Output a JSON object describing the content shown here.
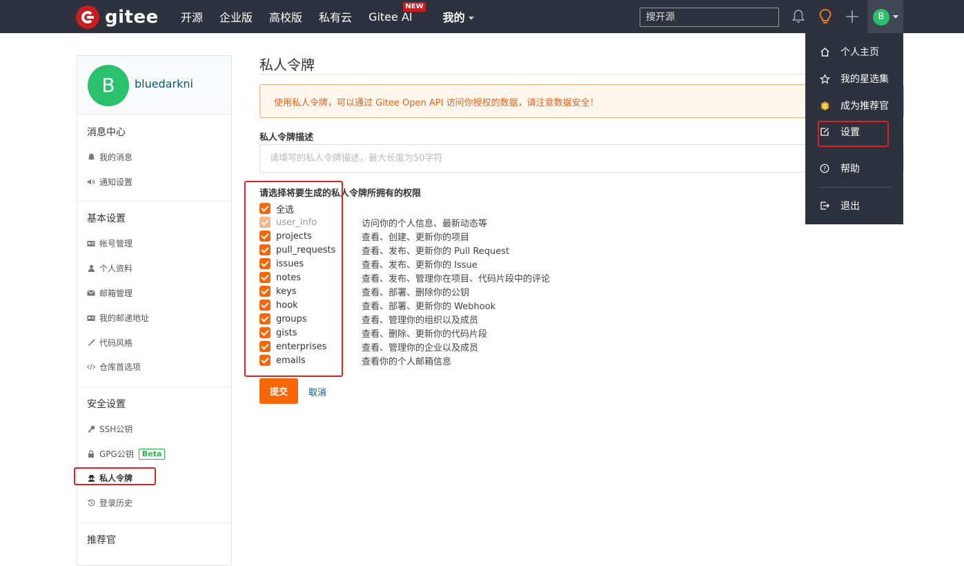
{
  "topbar": {
    "logo_text": "gitee",
    "nav": [
      {
        "label": "开源"
      },
      {
        "label": "企业版"
      },
      {
        "label": "高校版"
      },
      {
        "label": "私有云"
      },
      {
        "label": "Gitee AI",
        "badge": "NEW"
      },
      {
        "label": "我的"
      }
    ],
    "search_placeholder": "搜开源",
    "avatar_letter": "B",
    "icons": [
      "bell-icon",
      "lightbulb-icon",
      "plus-icon"
    ]
  },
  "dropdown": {
    "items": [
      {
        "label": "个人主页",
        "icon": "home-icon"
      },
      {
        "label": "我的星选集",
        "icon": "star-icon"
      },
      {
        "label": "成为推荐官",
        "icon": "gitee-badge-icon"
      },
      {
        "label": "设置",
        "icon": "edit-icon"
      },
      {
        "label": "帮助",
        "icon": "help-icon"
      },
      {
        "label": "退出",
        "icon": "logout-icon"
      }
    ]
  },
  "sidebar": {
    "avatar_letter": "B",
    "username": "bluedarkni",
    "sections": [
      {
        "title": "消息中心",
        "items": [
          {
            "label": "我的消息",
            "icon": "bell-icon"
          },
          {
            "label": "通知设置",
            "icon": "speaker-icon"
          }
        ]
      },
      {
        "title": "基本设置",
        "items": [
          {
            "label": "帐号管理",
            "icon": "id-card-icon"
          },
          {
            "label": "个人资料",
            "icon": "user-icon"
          },
          {
            "label": "邮箱管理",
            "icon": "mail-icon"
          },
          {
            "label": "我的邮递地址",
            "icon": "address-card-icon"
          },
          {
            "label": "代码风格",
            "icon": "brush-icon"
          },
          {
            "label": "仓库首选项",
            "icon": "code-icon"
          }
        ]
      },
      {
        "title": "安全设置",
        "items": [
          {
            "label": "SSH公钥",
            "icon": "key-icon"
          },
          {
            "label": "GPG公钥",
            "icon": "lock-icon",
            "badge": "Beta"
          },
          {
            "label": "私人令牌",
            "icon": "user-secret-icon",
            "active": true
          },
          {
            "label": "登录历史",
            "icon": "history-icon"
          }
        ]
      },
      {
        "title": "推荐官",
        "items": []
      }
    ]
  },
  "main": {
    "title": "私人令牌",
    "notice": "使用私人令牌，可以通过 Gitee Open API 访问你授权的数据，请注意数据安全！",
    "desc_label": "私人令牌描述",
    "desc_placeholder": "请填写的私人令牌描述，最大长度为50字符",
    "perm_label": "请选择将要生成的私人令牌所拥有的权限",
    "permissions": [
      {
        "name": "全选",
        "desc": "",
        "checked": true
      },
      {
        "name": "user_info",
        "desc": "访问你的个人信息、最新动态等",
        "checked": true,
        "disabled": true
      },
      {
        "name": "projects",
        "desc": "查看、创建、更新你的项目",
        "checked": true
      },
      {
        "name": "pull_requests",
        "desc": "查看、发布、更新你的 Pull Request",
        "checked": true
      },
      {
        "name": "issues",
        "desc": "查看、发布、更新你的 Issue",
        "checked": true
      },
      {
        "name": "notes",
        "desc": "查看、发布、管理你在项目、代码片段中的评论",
        "checked": true
      },
      {
        "name": "keys",
        "desc": "查看、部署、删除你的公钥",
        "checked": true
      },
      {
        "name": "hook",
        "desc": "查看、部署、更新你的 Webhook",
        "checked": true
      },
      {
        "name": "groups",
        "desc": "查看、管理你的组织以及成员",
        "checked": true
      },
      {
        "name": "gists",
        "desc": "查看、删除、更新你的代码片段",
        "checked": true
      },
      {
        "name": "enterprises",
        "desc": "查看、管理你的企业以及成员",
        "checked": true
      },
      {
        "name": "emails",
        "desc": "查看你的个人邮箱信息",
        "checked": true
      }
    ],
    "submit_label": "提交",
    "cancel_label": "取消"
  },
  "colors": {
    "navbar_bg": "#2d323e",
    "accent_orange": "#f76707",
    "brand_red": "#c71d23",
    "avatar_green": "#29c16c",
    "annotation_red": "#e02020"
  }
}
